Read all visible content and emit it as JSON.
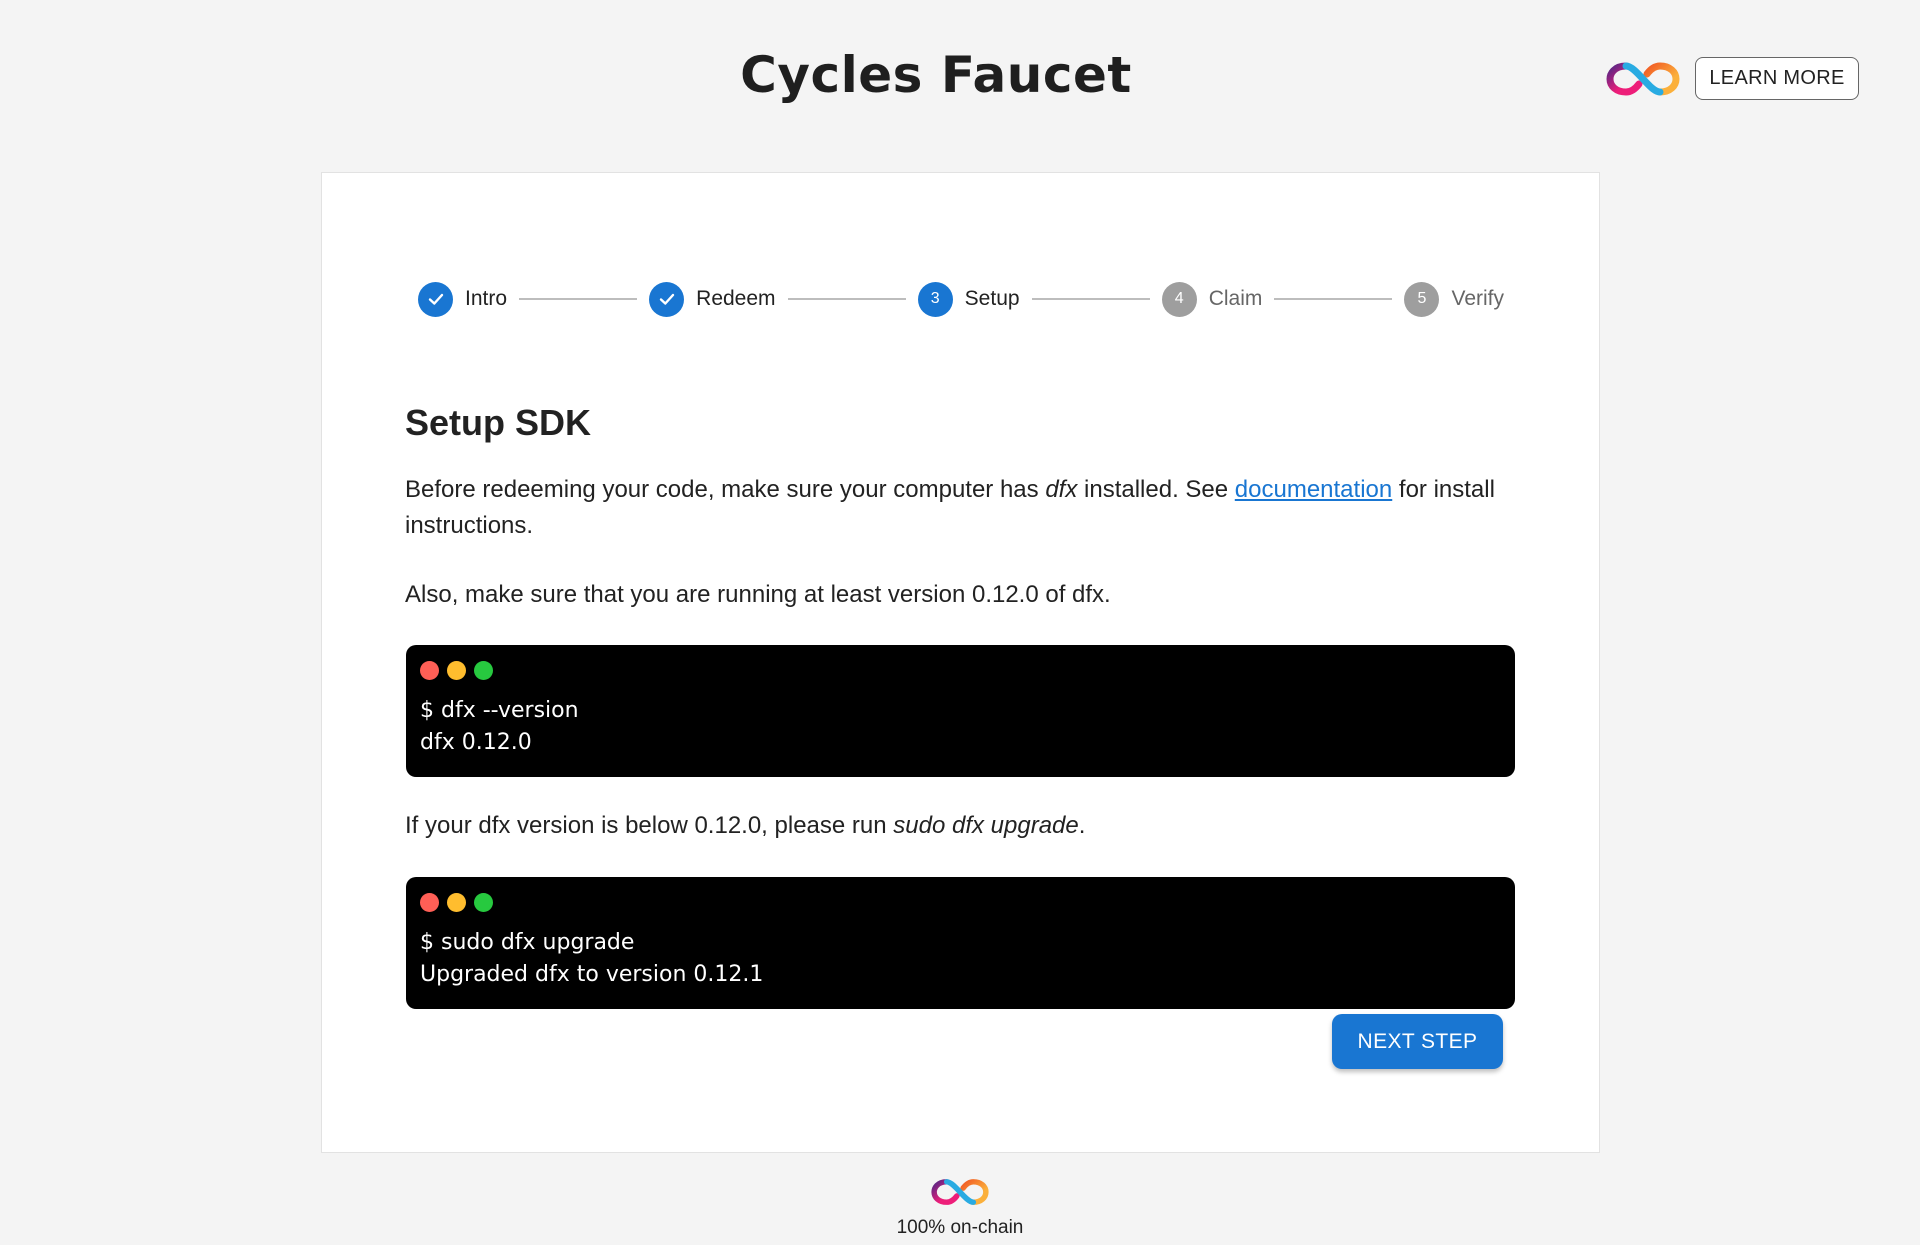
{
  "header": {
    "title": "Cycles Faucet",
    "learn_more_label": "LEARN MORE",
    "logo_icon": "infinity-logo-icon"
  },
  "stepper": {
    "steps": [
      {
        "label": "Intro",
        "state": "completed",
        "number": "1"
      },
      {
        "label": "Redeem",
        "state": "completed",
        "number": "2"
      },
      {
        "label": "Setup",
        "state": "active",
        "number": "3"
      },
      {
        "label": "Claim",
        "state": "pending",
        "number": "4"
      },
      {
        "label": "Verify",
        "state": "pending",
        "number": "5"
      }
    ]
  },
  "main": {
    "heading": "Setup SDK",
    "intro_part1": "Before redeeming your code, make sure your computer has ",
    "intro_em": "dfx",
    "intro_part2": " installed. See ",
    "intro_link": "documentation",
    "intro_part3": " for install instructions.",
    "version_note": "Also, make sure that you are running at least version 0.12.0 of dfx.",
    "terminal1": {
      "lines": [
        "$ dfx --version",
        "dfx 0.12.0"
      ]
    },
    "upgrade_part1": "If your dfx version is below 0.12.0, please run ",
    "upgrade_em": "sudo dfx upgrade",
    "upgrade_part2": ".",
    "terminal2": {
      "lines": [
        "$ sudo dfx upgrade",
        "Upgraded dfx to version 0.12.1"
      ]
    },
    "next_step_label": "NEXT STEP"
  },
  "footer": {
    "text": "100% on-chain"
  },
  "colors": {
    "accent": "#1976d2",
    "inactive": "#9e9e9e",
    "dot_red": "#ff5f56",
    "dot_yellow": "#ffbd2e",
    "dot_green": "#27c93f"
  }
}
